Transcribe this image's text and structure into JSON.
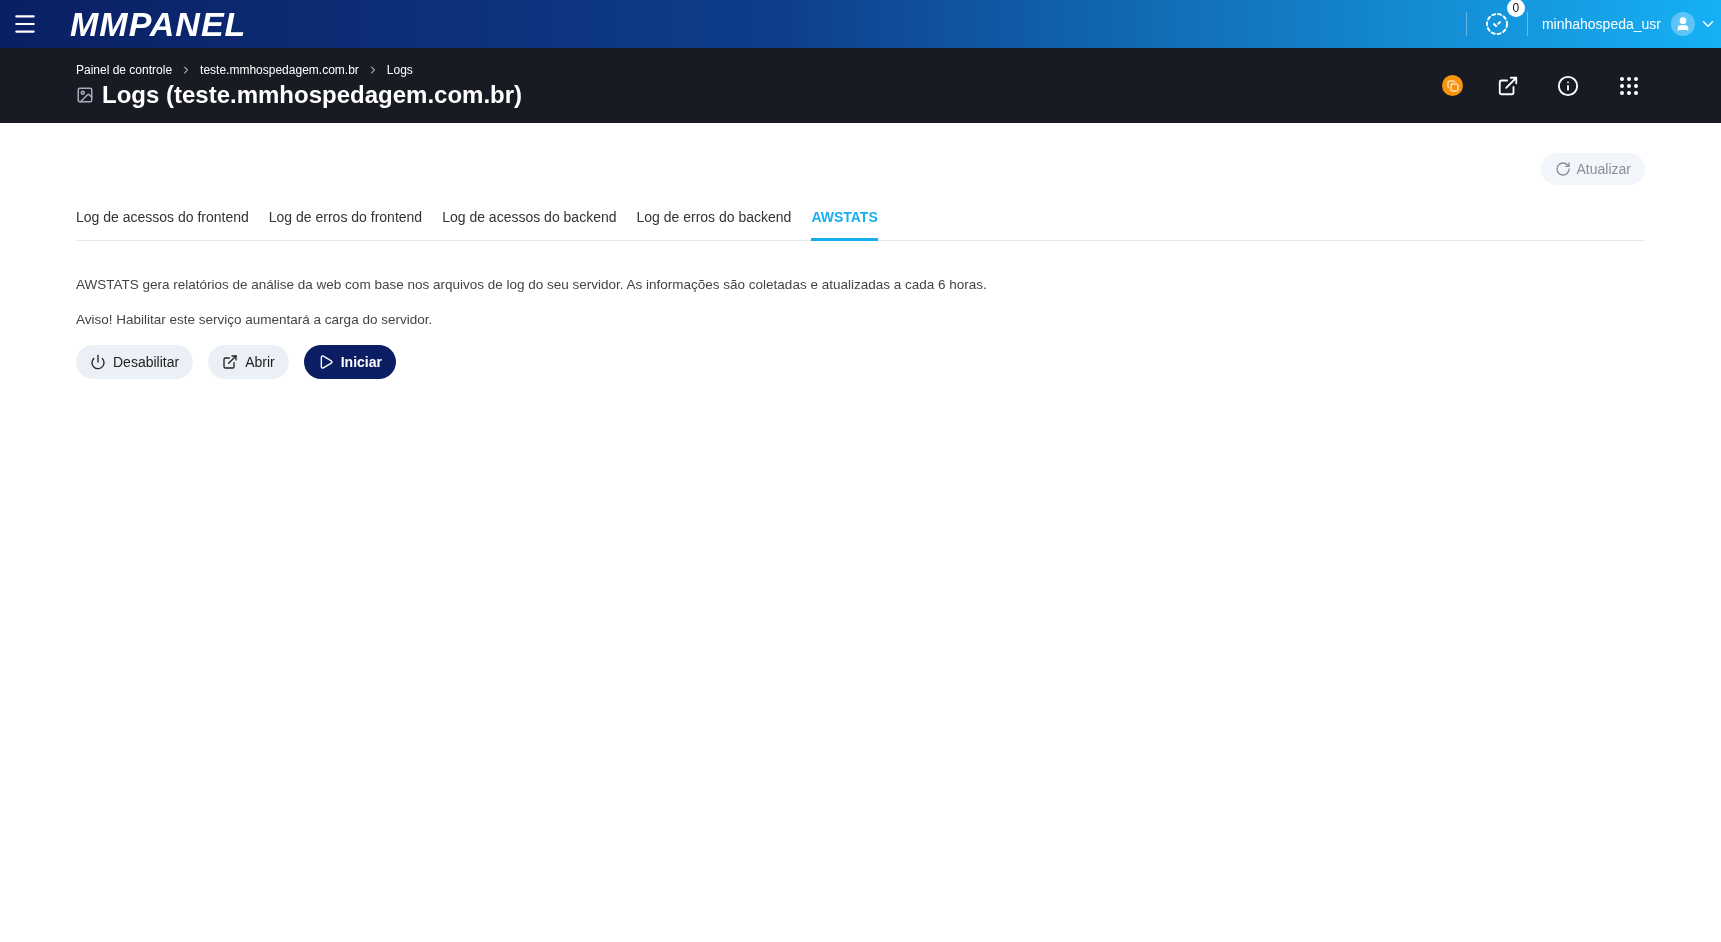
{
  "topbar": {
    "logo": "MMPANEL",
    "notifications": "0",
    "user": "minhahospeda_usr"
  },
  "header": {
    "breadcrumbs": [
      "Painel de controle",
      "teste.mmhospedagem.com.br",
      "Logs"
    ],
    "title": "Logs (teste.mmhospedagem.com.br)"
  },
  "refresh": {
    "label": "Atualizar",
    "disabled": true
  },
  "tabs": [
    {
      "label": "Log de acessos do frontend",
      "selected": false
    },
    {
      "label": "Log de erros do frontend",
      "selected": false
    },
    {
      "label": "Log de acessos do backend",
      "selected": false
    },
    {
      "label": "Log de erros do backend",
      "selected": false
    },
    {
      "label": "AWSTATS",
      "selected": true
    }
  ],
  "description": "AWSTATS gera relatórios de análise da web com base nos arquivos de log do seu servidor. As informações são coletadas e atualizadas a cada 6 horas.",
  "warning": "Aviso! Habilitar este serviço aumentará a carga do servidor.",
  "buttons": [
    {
      "label": "Desabilitar",
      "kind": "power"
    },
    {
      "label": "Abrir",
      "kind": "open"
    },
    {
      "label": "Iniciar",
      "kind": "start"
    }
  ]
}
